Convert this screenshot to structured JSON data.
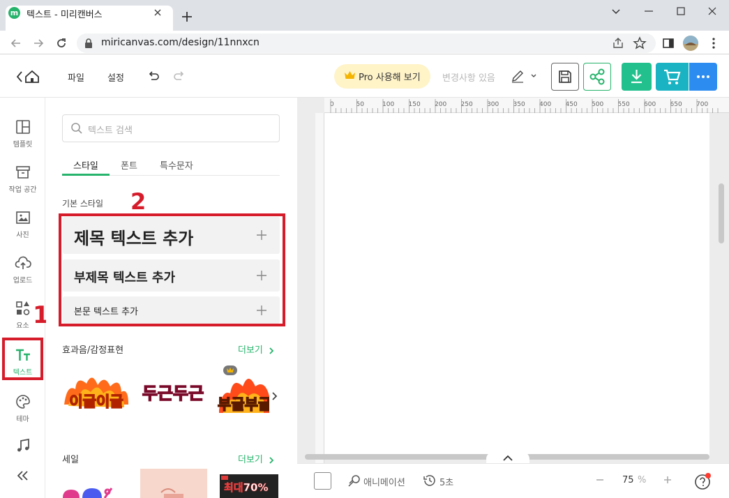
{
  "browser": {
    "tab_title": "텍스트 - 미리캔버스",
    "favicon_letter": "m",
    "url": "miricanvas.com/design/11nnxcn"
  },
  "header": {
    "menu_file": "파일",
    "menu_settings": "설정",
    "pro_label": "Pro 사용해 보기",
    "changes_label": "변경사항 있음"
  },
  "rail": {
    "items": [
      {
        "label": "템플릿"
      },
      {
        "label": "작업 공간"
      },
      {
        "label": "사진"
      },
      {
        "label": "업로드"
      },
      {
        "label": "요소"
      },
      {
        "label": "텍스트"
      },
      {
        "label": "테마"
      },
      {
        "label": ""
      }
    ]
  },
  "panel": {
    "search_placeholder": "텍스트 검색",
    "tabs": [
      "스타일",
      "폰트",
      "특수문자"
    ],
    "basic_title": "기본 스타일",
    "title_text": "제목 텍스트 추가",
    "subtitle_text": "부제목 텍스트 추가",
    "body_text": "본문 텍스트 추가",
    "effects_title": "효과음/감정표현",
    "more_label": "더보기",
    "sale_title": "세일",
    "effects_samples": [
      "이글이글",
      "두근두근",
      "부글부글"
    ],
    "sale_sample": "최대70%"
  },
  "annotations": {
    "num1": "1",
    "num2": "2"
  },
  "ruler": {
    "ticks": [
      "0",
      "50",
      "100",
      "150",
      "200",
      "250",
      "300",
      "350",
      "400",
      "450",
      "500",
      "550",
      "600",
      "650",
      "700"
    ]
  },
  "bottombar": {
    "animation_label": "애니메이션",
    "duration_label": "5초",
    "zoom_value": "75",
    "zoom_unit": "%"
  },
  "colors": {
    "brand_green": "#26b36b",
    "download_green": "#21c08c",
    "cart_teal": "#19b3c3",
    "more_blue": "#2d8cf0",
    "annotation_red": "#d61c2b"
  }
}
